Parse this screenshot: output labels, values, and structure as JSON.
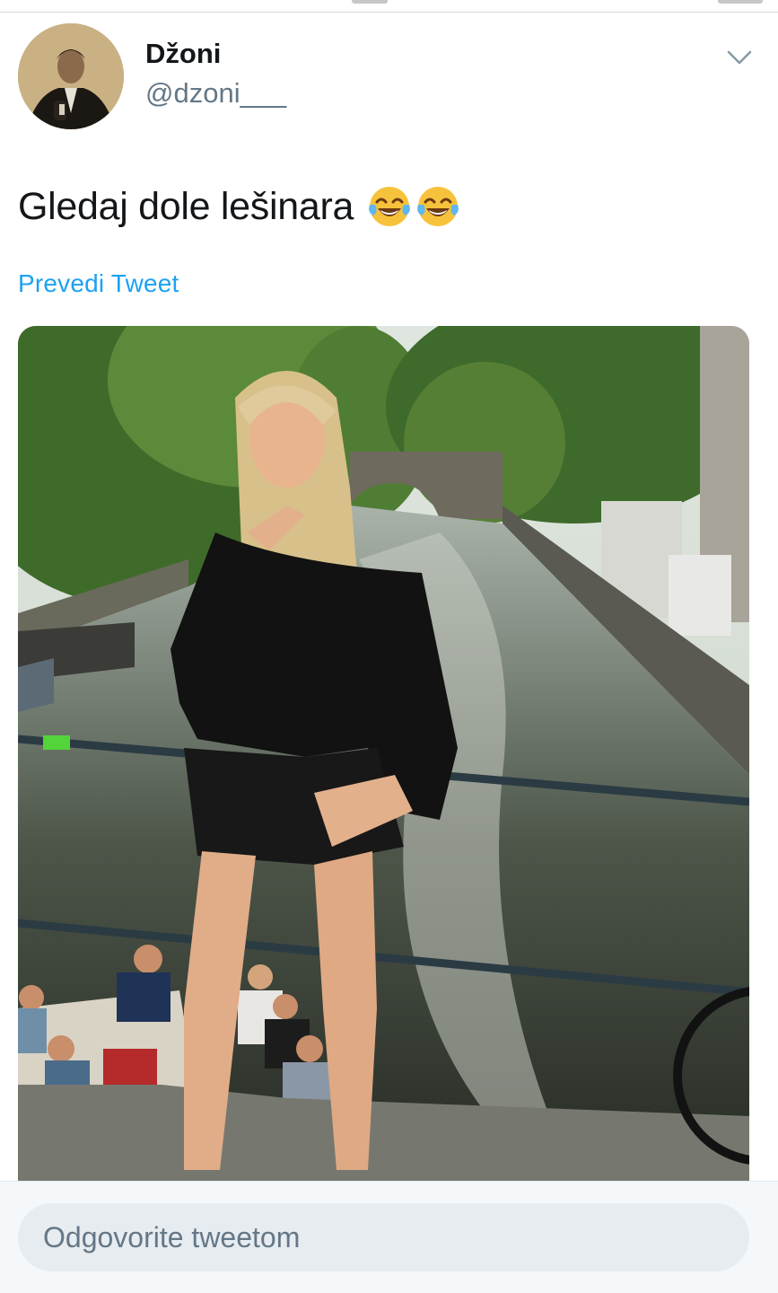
{
  "tweet": {
    "author_name": "Džoni",
    "author_handle": "@dzoni___",
    "text": "Gledaj dole lešinara",
    "emojis": [
      "face-with-tears-of-joy",
      "face-with-tears-of-joy"
    ],
    "translate_label": "Prevedi Tweet"
  },
  "reply": {
    "placeholder": "Odgovorite tweetom"
  },
  "colors": {
    "link": "#1da1f2",
    "secondary_text": "#657786",
    "primary_text": "#14171a",
    "reply_field": "#e6ecf0"
  },
  "icons": {
    "more": "chevron-down-icon",
    "emoji": "face-with-tears-of-joy"
  }
}
